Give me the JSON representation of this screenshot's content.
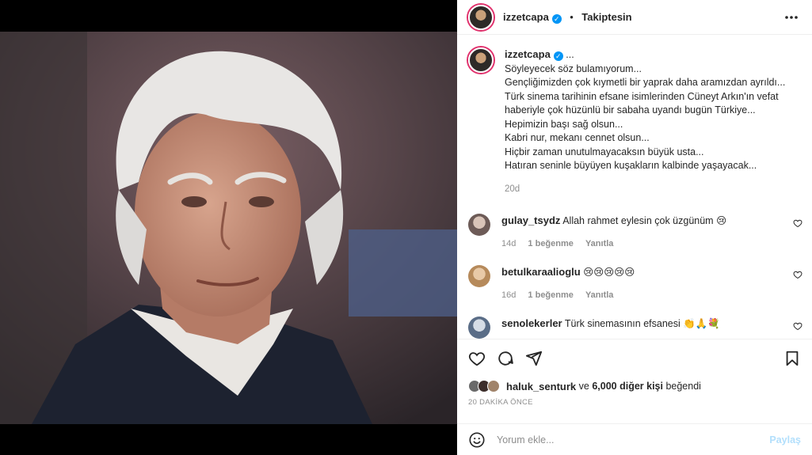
{
  "header": {
    "username": "izzetcapa",
    "separator": "•",
    "follow_status": "Takiptesin",
    "more_icon": "ellipsis-icon"
  },
  "caption": {
    "username": "izzetcapa",
    "title": "...",
    "lines": [
      "Söyleyecek söz bulamıyorum...",
      "Gençliğimizden çok kıymetli bir yaprak daha aramızdan ayrıldı...",
      "Türk sinema tarihinin efsane isimlerinden Cüneyt Arkın'ın vefat haberiyle çok hüzünlü bir sabaha uyandı bugün Türkiye...",
      "Hepimizin başı sağ olsun...",
      "Kabri nur, mekanı cennet olsun...",
      "Hiçbir zaman unutulmayacaksın büyük usta...",
      "Hatıran seninle büyüyen kuşakların kalbinde yaşayacak..."
    ],
    "time": "20d"
  },
  "comments": [
    {
      "username": "gulay_tsydz",
      "text": "Allah rahmet eylesin çok üzgünüm 😢",
      "time": "14d",
      "likes": "1 beğenme",
      "reply": "Yanıtla"
    },
    {
      "username": "betulkaraalioglu",
      "text": "😢😢😢😢😢",
      "time": "16d",
      "likes": "1 beğenme",
      "reply": "Yanıtla"
    },
    {
      "username": "senolekerler",
      "text": "Türk sinemasının efsanesi 👏🙏💐",
      "time": "",
      "likes": "",
      "reply": ""
    }
  ],
  "likes": {
    "first_user": "haluk_senturk",
    "connector": "ve",
    "others": "6,000 diğer kişi",
    "suffix": "beğendi"
  },
  "posted_ago": "20 DAKİKA ÖNCE",
  "add_comment": {
    "placeholder": "Yorum ekle...",
    "post_label": "Paylaş"
  },
  "colors": {
    "verified": "#0095f6",
    "muted": "#8e8e8e",
    "post_disabled": "#b2dffc"
  }
}
